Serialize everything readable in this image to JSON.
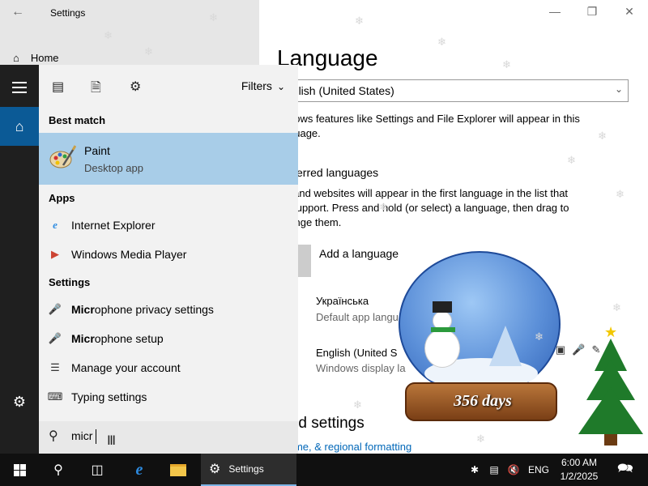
{
  "settings_window": {
    "title": "Settings",
    "home_label": "Home",
    "page_title": "Language",
    "language_select_value": "nglish (United States)",
    "windows_display_text_1": "dows features like Settings and File Explorer will appear in this",
    "windows_display_text_2": "guage.",
    "preferred_heading": "erred languages",
    "preferred_text_1": "s and websites will appear in the first language in the list that",
    "preferred_text_2": "/ support. Press and hold (or select) a language, then drag to",
    "preferred_text_3": "range them.",
    "add_language_label": "Add a language",
    "languages": [
      {
        "name": "Українська",
        "sub": "Default app langu"
      },
      {
        "name": "English (United S",
        "sub": "Windows display la"
      }
    ],
    "related_heading": "ated settings",
    "related_link": "e, time, & regional formatting"
  },
  "start_menu": {
    "filters_label": "Filters",
    "best_match_header": "Best match",
    "best_match": {
      "title": "Paint",
      "subtitle": "Desktop app",
      "icon": "paint-icon"
    },
    "apps_header": "Apps",
    "apps": [
      {
        "label": "Internet Explorer",
        "icon": "ie-icon"
      },
      {
        "label": "Windows Media Player",
        "icon": "media-player-icon"
      }
    ],
    "settings_header": "Settings",
    "settings_results": [
      {
        "bold": "Micr",
        "rest": "ophone privacy settings",
        "icon": "microphone-icon"
      },
      {
        "bold": "Micr",
        "rest": "ophone setup",
        "icon": "microphone-icon"
      },
      {
        "bold": "",
        "rest": "Manage your account",
        "icon": "account-list-icon"
      },
      {
        "bold": "",
        "rest": "Typing settings",
        "icon": "keyboard-icon"
      }
    ],
    "search_value": "micr"
  },
  "overlay": {
    "days_label": "356 days"
  },
  "taskbar": {
    "active_app_label": "Settings",
    "language": "ENG",
    "time": "6:00 AM",
    "date": "1/2/2025"
  }
}
